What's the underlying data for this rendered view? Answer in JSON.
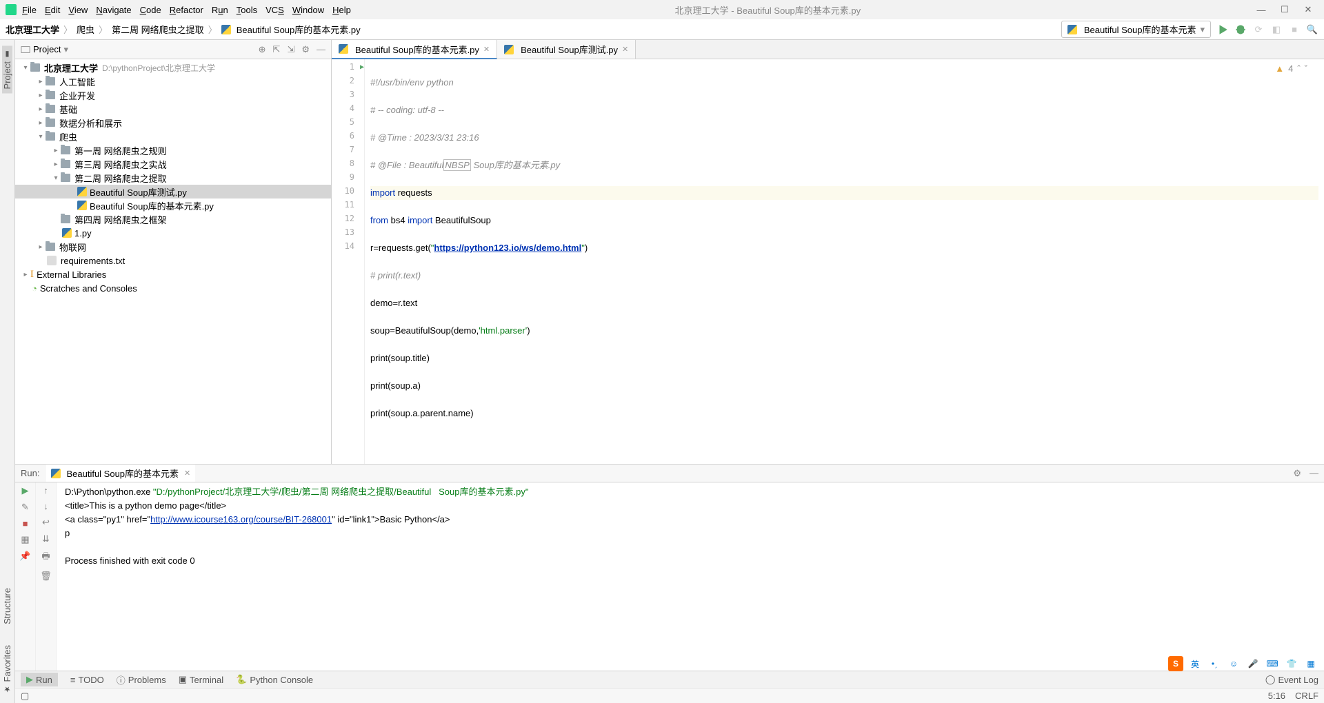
{
  "window": {
    "title": "北京理工大学 - Beautiful  Soup库的基本元素.py",
    "menus": [
      "File",
      "Edit",
      "View",
      "Navigate",
      "Code",
      "Refactor",
      "Run",
      "Tools",
      "VCS",
      "Window",
      "Help"
    ]
  },
  "breadcrumb": {
    "p1": "北京理工大学",
    "p2": "爬虫",
    "p3": "第二周 网络爬虫之提取",
    "p4": "Beautiful  Soup库的基本元素.py"
  },
  "run_config": {
    "label": "Beautiful  Soup库的基本元素"
  },
  "project": {
    "header": "Project",
    "root": {
      "name": "北京理工大学",
      "path": "D:\\pythonProject\\北京理工大学"
    },
    "folders": {
      "a": "人工智能",
      "b": "企业开发",
      "c": "基础",
      "d": "数据分析和展示",
      "e": "爬虫"
    },
    "weeks": {
      "w1": "第一周 网络爬虫之规则",
      "w3": "第三周 网络爬虫之实战",
      "w2": "第二周 网络爬虫之提取",
      "w4": "第四周 网络爬虫之框架"
    },
    "files": {
      "f1": "Beautiful Soup库测试.py",
      "f2": "Beautiful  Soup库的基本元素.py",
      "f3": "1.py",
      "f4": "requirements.txt"
    },
    "ext": "External Libraries",
    "scratch": "Scratches and Consoles"
  },
  "tabs": {
    "t1": "Beautiful  Soup库的基本元素.py",
    "t2": "Beautiful Soup库测试.py"
  },
  "editor": {
    "warnings": "4",
    "line_count": 13
  },
  "run": {
    "label": "Run:",
    "tab": "Beautiful  Soup库的基本元素",
    "exec_path": "D:\\Python\\python.exe ",
    "exec_arg": "\"D:/pythonProject/北京理工大学/爬虫/第二周 网络爬虫之提取/Beautiful   Soup库的基本元素.py\"",
    "out1": "<title>This is a python demo page</title>",
    "out2_a": "<a class=\"py1\" href=\"",
    "out2_link": "http://www.icourse163.org/course/BIT-268001",
    "out2_b": "\" id=\"link1\">Basic Python</a>",
    "out3": "p",
    "exit": "Process finished with exit code 0"
  },
  "bottom": {
    "run": "Run",
    "todo": "TODO",
    "problems": "Problems",
    "terminal": "Terminal",
    "pyconsole": "Python Console",
    "eventlog": "Event Log"
  },
  "status": {
    "pos": "5:16",
    "sep": "CRLF"
  },
  "sidebars": {
    "project": "Project",
    "structure": "Structure",
    "favorites": "Favorites"
  }
}
